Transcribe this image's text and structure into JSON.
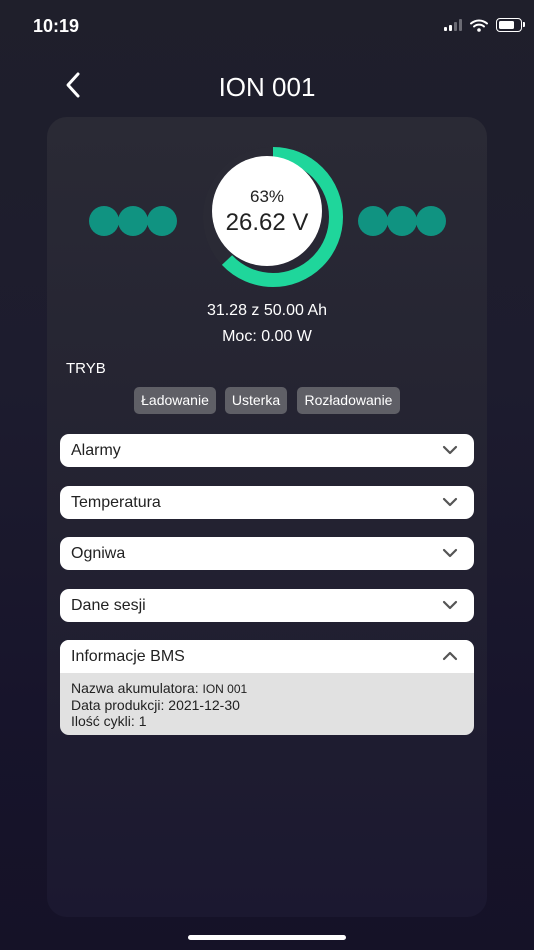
{
  "status_bar": {
    "time": "10:19"
  },
  "header": {
    "title": "ION 001"
  },
  "battery": {
    "percent_label": "63%",
    "percent": 0.63,
    "voltage": "26.62 V",
    "capacity": "31.28 z 50.00 Ah",
    "power": "Moc: 0.00 W",
    "accent_color": "#1fd69b",
    "dot_color": "#109381"
  },
  "mode": {
    "label": "TRYB",
    "buttons": [
      "Ładowanie",
      "Usterka",
      "Rozładowanie"
    ]
  },
  "sections": [
    {
      "label": "Alarmy"
    },
    {
      "label": "Temperatura"
    },
    {
      "label": "Ogniwa"
    },
    {
      "label": "Dane sesji"
    }
  ],
  "bms": {
    "label": "Informacje BMS",
    "rows": [
      {
        "key": "Nazwa akumulatora:",
        "value": "ION 001"
      },
      {
        "key": "Data produkcji:",
        "value": "2021-12-30"
      },
      {
        "key": "Ilość cykli:",
        "value": "1"
      }
    ]
  }
}
